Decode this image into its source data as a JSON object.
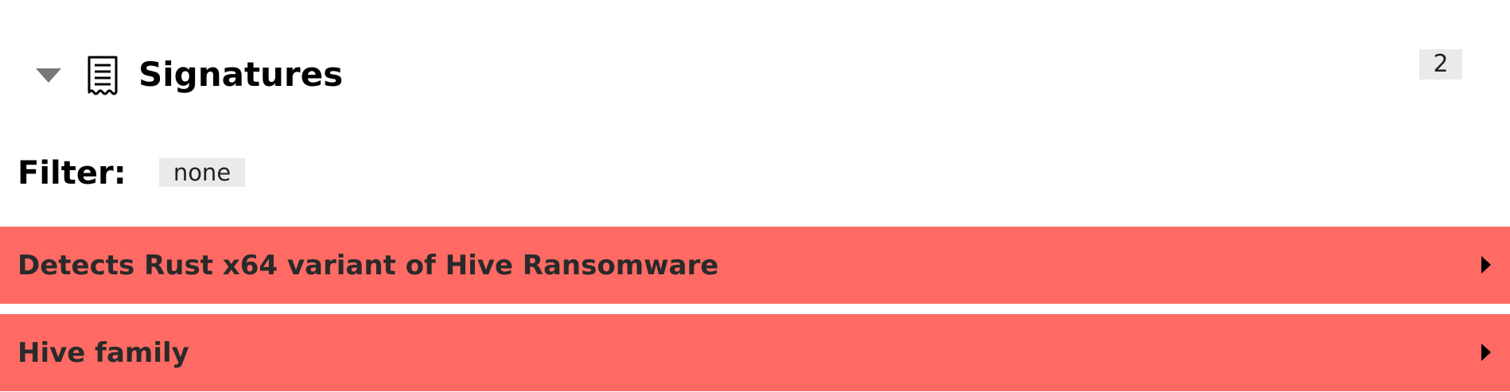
{
  "section": {
    "title": "Signatures",
    "count": "2",
    "toggle_icon": "triangle-down-icon",
    "header_icon": "receipt-icon"
  },
  "filter": {
    "label": "Filter:",
    "value": "none"
  },
  "signatures": [
    {
      "label": "Detects Rust x64 variant of Hive Ransomware",
      "severity_color": "#ff6b64"
    },
    {
      "label": "Hive family",
      "severity_color": "#ff6b64"
    }
  ],
  "colors": {
    "badge_bg": "#eaeaea",
    "severity": "#ff6b64",
    "toggle": "#777777"
  }
}
